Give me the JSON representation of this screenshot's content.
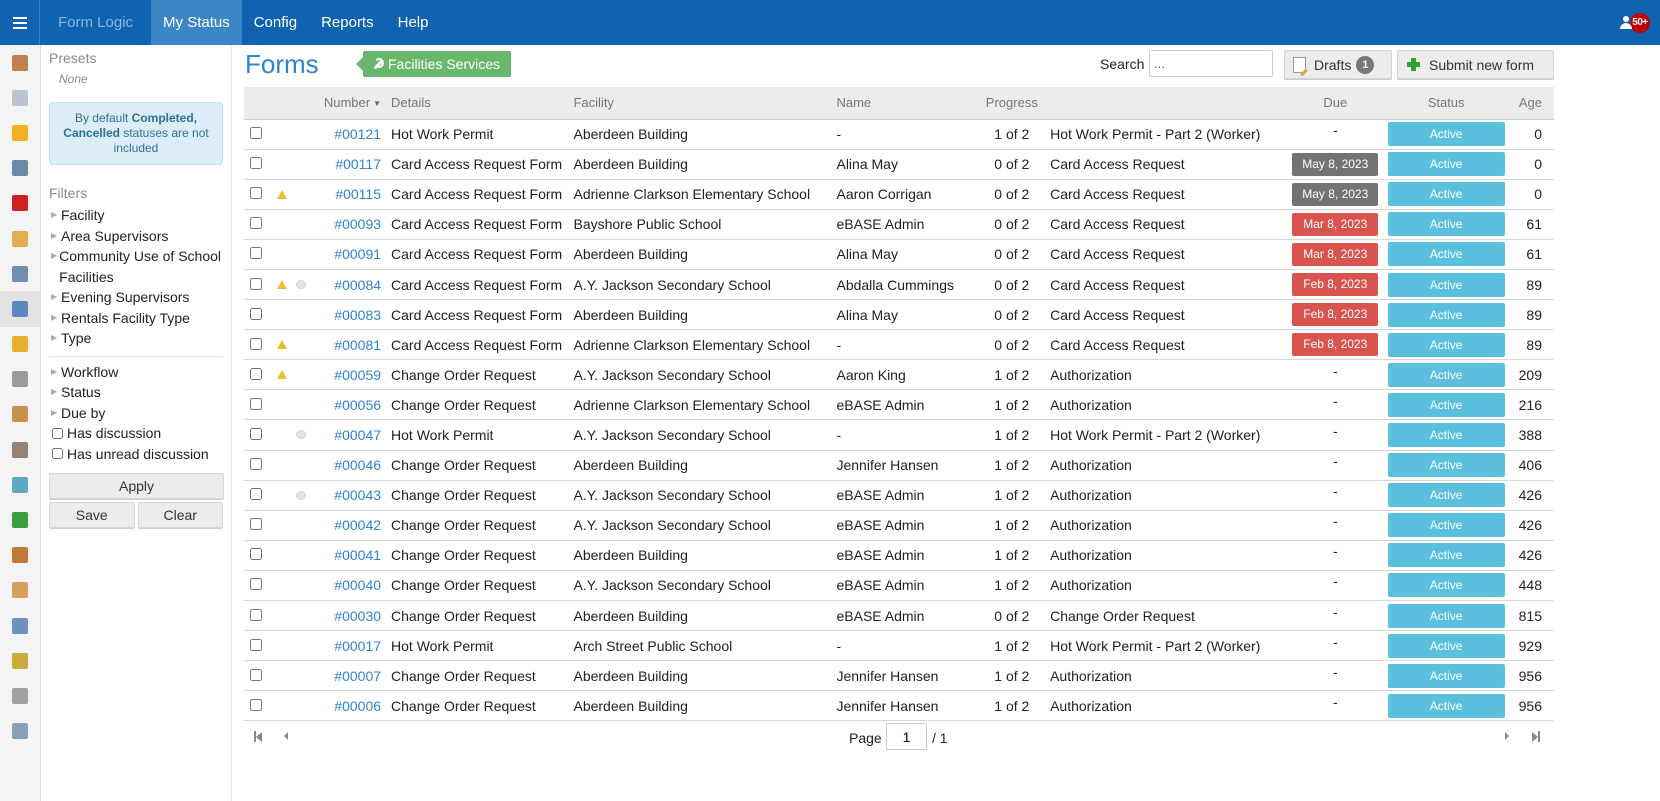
{
  "topbar": {
    "brand": "Form Logic",
    "nav": [
      {
        "label": "My Status",
        "active": true
      },
      {
        "label": "Config",
        "active": false
      },
      {
        "label": "Reports",
        "active": false
      },
      {
        "label": "Help",
        "active": false
      }
    ],
    "notification_count": "50+"
  },
  "rail": {
    "items": [
      {
        "icon": "home-icon",
        "color": "#c08050"
      },
      {
        "icon": "documents-icon",
        "color": "#b8c4d0"
      },
      {
        "icon": "hard-hat-icon",
        "color": "#f0b020"
      },
      {
        "icon": "computer-icon",
        "color": "#6a8aa8"
      },
      {
        "icon": "first-aid-icon",
        "color": "#d02020"
      },
      {
        "icon": "folder-icon",
        "color": "#e0b050"
      },
      {
        "icon": "bus-icon",
        "color": "#7090b0"
      },
      {
        "icon": "window-settings-icon",
        "color": "#5a88c0",
        "active": true
      },
      {
        "icon": "building-warning-icon",
        "color": "#e8b030"
      },
      {
        "icon": "wrench-icon",
        "color": "#9a9a9a"
      },
      {
        "icon": "clipboard-icon",
        "color": "#c89050"
      },
      {
        "icon": "magnifier-doc-icon",
        "color": "#9a8070"
      },
      {
        "icon": "flask-warning-icon",
        "color": "#60a8c0"
      },
      {
        "icon": "puzzle-icon",
        "color": "#3aa040"
      },
      {
        "icon": "address-book-icon",
        "color": "#c07838"
      },
      {
        "icon": "package-icon",
        "color": "#d8a060"
      },
      {
        "icon": "alarm-clock-icon",
        "color": "#7090c0"
      },
      {
        "icon": "key-icon",
        "color": "#d0a840"
      },
      {
        "icon": "truck-icon",
        "color": "#a0a0a0"
      },
      {
        "icon": "notepad-icon",
        "color": "#8aa0b8"
      }
    ]
  },
  "filters": {
    "presets_title": "Presets",
    "presets_value": "None",
    "info_prefix": "By default ",
    "info_bold": "Completed, Cancelled",
    "info_suffix": " statuses are not included",
    "filters_title": "Filters",
    "group1": [
      "Facility",
      "Area Supervisors",
      "Community Use of School Facilities",
      "Evening Supervisors",
      "Rentals Facility Type",
      "Type"
    ],
    "group2": [
      "Workflow",
      "Status",
      "Due by"
    ],
    "checkboxes": [
      {
        "label": "Has discussion",
        "checked": false
      },
      {
        "label": "Has unread discussion",
        "checked": false
      }
    ],
    "apply_label": "Apply",
    "save_label": "Save",
    "clear_label": "Clear"
  },
  "main": {
    "title": "Forms",
    "department_tag": "Facilities Services",
    "search_label": "Search",
    "search_value": "...",
    "drafts_label": "Drafts",
    "drafts_count": "1",
    "submit_label": "Submit new form",
    "columns": {
      "number": "Number",
      "details": "Details",
      "facility": "Facility",
      "name": "Name",
      "progress": "Progress",
      "due": "Due",
      "status": "Status",
      "age": "Age"
    },
    "rows": [
      {
        "warn": false,
        "discussion": false,
        "number": "#00121",
        "details": "Hot Work Permit",
        "facility": "Aberdeen Building",
        "name": "-",
        "progress": "1 of 2",
        "step": "Hot Work Permit - Part 2 (Worker)",
        "due": "-",
        "due_style": "none",
        "status": "Active",
        "age": "0"
      },
      {
        "warn": false,
        "discussion": false,
        "number": "#00117",
        "details": "Card Access Request Form",
        "facility": "Aberdeen Building",
        "name": "Alina May",
        "progress": "0 of 2",
        "step": "Card Access Request",
        "due": "May 8, 2023",
        "due_style": "gray",
        "status": "Active",
        "age": "0"
      },
      {
        "warn": true,
        "discussion": false,
        "number": "#00115",
        "details": "Card Access Request Form",
        "facility": "Adrienne Clarkson Elementary School",
        "name": "Aaron Corrigan",
        "progress": "0 of 2",
        "step": "Card Access Request",
        "due": "May 8, 2023",
        "due_style": "gray",
        "status": "Active",
        "age": "0"
      },
      {
        "warn": false,
        "discussion": false,
        "number": "#00093",
        "details": "Card Access Request Form",
        "facility": "Bayshore Public School",
        "name": "eBASE Admin",
        "progress": "0 of 2",
        "step": "Card Access Request",
        "due": "Mar 8, 2023",
        "due_style": "red",
        "status": "Active",
        "age": "61"
      },
      {
        "warn": false,
        "discussion": false,
        "number": "#00091",
        "details": "Card Access Request Form",
        "facility": "Aberdeen Building",
        "name": "Alina May",
        "progress": "0 of 2",
        "step": "Card Access Request",
        "due": "Mar 8, 2023",
        "due_style": "red",
        "status": "Active",
        "age": "61"
      },
      {
        "warn": true,
        "discussion": true,
        "number": "#00084",
        "details": "Card Access Request Form",
        "facility": "A.Y. Jackson Secondary School",
        "name": "Abdalla Cummings",
        "progress": "0 of 2",
        "step": "Card Access Request",
        "due": "Feb 8, 2023",
        "due_style": "red",
        "status": "Active",
        "age": "89"
      },
      {
        "warn": false,
        "discussion": false,
        "number": "#00083",
        "details": "Card Access Request Form",
        "facility": "Aberdeen Building",
        "name": "Alina May",
        "progress": "0 of 2",
        "step": "Card Access Request",
        "due": "Feb 8, 2023",
        "due_style": "red",
        "status": "Active",
        "age": "89"
      },
      {
        "warn": true,
        "discussion": false,
        "number": "#00081",
        "details": "Card Access Request Form",
        "facility": "Adrienne Clarkson Elementary School",
        "name": "-",
        "progress": "0 of 2",
        "step": "Card Access Request",
        "due": "Feb 8, 2023",
        "due_style": "red",
        "status": "Active",
        "age": "89"
      },
      {
        "warn": true,
        "discussion": false,
        "number": "#00059",
        "details": "Change Order Request",
        "facility": "A.Y. Jackson Secondary School",
        "name": "Aaron King",
        "progress": "1 of 2",
        "step": "Authorization",
        "due": "-",
        "due_style": "none",
        "status": "Active",
        "age": "209"
      },
      {
        "warn": false,
        "discussion": false,
        "number": "#00056",
        "details": "Change Order Request",
        "facility": "Adrienne Clarkson Elementary School",
        "name": "eBASE Admin",
        "progress": "1 of 2",
        "step": "Authorization",
        "due": "-",
        "due_style": "none",
        "status": "Active",
        "age": "216"
      },
      {
        "warn": false,
        "discussion": true,
        "number": "#00047",
        "details": "Hot Work Permit",
        "facility": "A.Y. Jackson Secondary School",
        "name": "-",
        "progress": "1 of 2",
        "step": "Hot Work Permit - Part 2 (Worker)",
        "due": "-",
        "due_style": "none",
        "status": "Active",
        "age": "388"
      },
      {
        "warn": false,
        "discussion": false,
        "number": "#00046",
        "details": "Change Order Request",
        "facility": "Aberdeen Building",
        "name": "Jennifer Hansen",
        "progress": "1 of 2",
        "step": "Authorization",
        "due": "-",
        "due_style": "none",
        "status": "Active",
        "age": "406"
      },
      {
        "warn": false,
        "discussion": true,
        "number": "#00043",
        "details": "Change Order Request",
        "facility": "A.Y. Jackson Secondary School",
        "name": "eBASE Admin",
        "progress": "1 of 2",
        "step": "Authorization",
        "due": "-",
        "due_style": "none",
        "status": "Active",
        "age": "426"
      },
      {
        "warn": false,
        "discussion": false,
        "number": "#00042",
        "details": "Change Order Request",
        "facility": "A.Y. Jackson Secondary School",
        "name": "eBASE Admin",
        "progress": "1 of 2",
        "step": "Authorization",
        "due": "-",
        "due_style": "none",
        "status": "Active",
        "age": "426"
      },
      {
        "warn": false,
        "discussion": false,
        "number": "#00041",
        "details": "Change Order Request",
        "facility": "Aberdeen Building",
        "name": "eBASE Admin",
        "progress": "1 of 2",
        "step": "Authorization",
        "due": "-",
        "due_style": "none",
        "status": "Active",
        "age": "426"
      },
      {
        "warn": false,
        "discussion": false,
        "number": "#00040",
        "details": "Change Order Request",
        "facility": "A.Y. Jackson Secondary School",
        "name": "eBASE Admin",
        "progress": "1 of 2",
        "step": "Authorization",
        "due": "-",
        "due_style": "none",
        "status": "Active",
        "age": "448"
      },
      {
        "warn": false,
        "discussion": false,
        "number": "#00030",
        "details": "Change Order Request",
        "facility": "Aberdeen Building",
        "name": "eBASE Admin",
        "progress": "0 of 2",
        "step": "Change Order Request",
        "due": "-",
        "due_style": "none",
        "status": "Active",
        "age": "815"
      },
      {
        "warn": false,
        "discussion": false,
        "number": "#00017",
        "details": "Hot Work Permit",
        "facility": "Arch Street Public School",
        "name": "-",
        "progress": "1 of 2",
        "step": "Hot Work Permit - Part 2 (Worker)",
        "due": "-",
        "due_style": "none",
        "status": "Active",
        "age": "929"
      },
      {
        "warn": false,
        "discussion": false,
        "number": "#00007",
        "details": "Change Order Request",
        "facility": "Aberdeen Building",
        "name": "Jennifer Hansen",
        "progress": "1 of 2",
        "step": "Authorization",
        "due": "-",
        "due_style": "none",
        "status": "Active",
        "age": "956"
      },
      {
        "warn": false,
        "discussion": false,
        "number": "#00006",
        "details": "Change Order Request",
        "facility": "Aberdeen Building",
        "name": "Jennifer Hansen",
        "progress": "1 of 2",
        "step": "Authorization",
        "due": "-",
        "due_style": "none",
        "status": "Active",
        "age": "956"
      }
    ],
    "pager": {
      "page_label": "Page",
      "current_page": "1",
      "total": "/ 1"
    }
  },
  "colors": {
    "topbar": "#1063b0",
    "accent": "#2f84d0",
    "tag_green": "#68b76d",
    "status_active": "#5bc0de",
    "due_overdue": "#d9534f",
    "due_upcoming": "#737373"
  }
}
